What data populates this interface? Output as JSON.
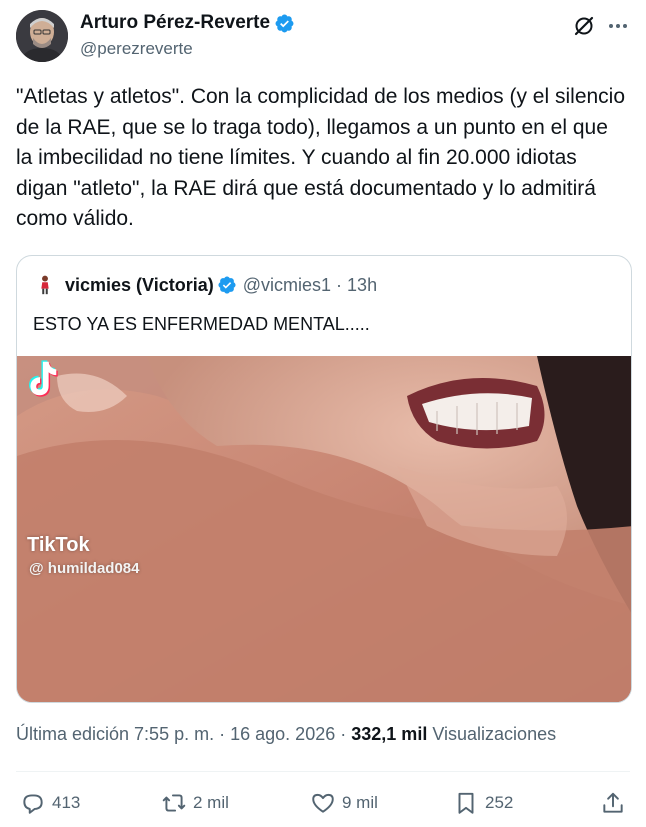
{
  "author": {
    "display_name": "Arturo Pérez-Reverte",
    "handle": "@perezreverte"
  },
  "tweet": {
    "text": "\"Atletas y atletos\". Con la complicidad de los medios (y el silencio de la RAE, que se lo traga todo), llegamos a un punto en el que la imbecilidad no tiene límites. Y cuando al fin 20.000 idiotas digan \"atleto\", la RAE dirá que está documentado y lo admitirá como válido."
  },
  "quote": {
    "display_name": "vicmies (Victoria)",
    "handle": "@vicmies1",
    "separator": "·",
    "time": "13h",
    "text": "ESTO YA ES ENFERMEDAD MENTAL.....",
    "media": {
      "watermark_brand": "TikTok",
      "watermark_user": "@ humildad084"
    }
  },
  "meta": {
    "edited": "Última edición 7:55 p. m.",
    "sep1": "·",
    "date": "16 ago. 2026",
    "sep2": "·",
    "views_count": "332,1 mil",
    "views_label": "Visualizaciones"
  },
  "actions": {
    "replies": "413",
    "reposts": "2 mil",
    "likes": "9 mil",
    "bookmarks": "252"
  },
  "colors": {
    "verified": "#1d9bf0",
    "secondary_text": "#536471",
    "primary_text": "#0f1419",
    "border": "#cfd9de"
  },
  "icons": [
    "verified-badge-icon",
    "grok-icon",
    "more-icon",
    "reply-icon",
    "repost-icon",
    "like-icon",
    "bookmark-icon",
    "share-icon",
    "tiktok-icon"
  ]
}
